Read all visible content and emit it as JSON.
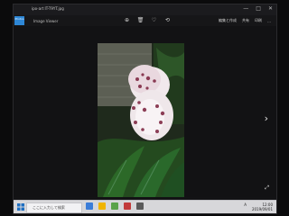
{
  "window": {
    "title": "ipo-art IT-T9YT.jpg",
    "controls": [
      "—",
      "□",
      "✕"
    ]
  },
  "app": {
    "tile_label": "Photos",
    "secondary_label": "Image Viewer"
  },
  "toolbar": {
    "tools": [
      {
        "name": "zoom-icon",
        "glyph": "⊕"
      },
      {
        "name": "delete-icon",
        "glyph": "🗑"
      },
      {
        "name": "favorite-icon",
        "glyph": "♡"
      },
      {
        "name": "rotate-icon",
        "glyph": "⟲"
      }
    ],
    "right": [
      {
        "name": "edit-create-button",
        "label": "編集と作成"
      },
      {
        "name": "share-button",
        "label": "共有"
      },
      {
        "name": "print-button",
        "label": "印刷"
      },
      {
        "name": "more-button",
        "label": "…"
      }
    ]
  },
  "viewer": {
    "next_glyph": "›",
    "expand_glyph": "⤢"
  },
  "taskbar": {
    "search_placeholder": "ここに入力して検索",
    "clock_time": "12:00",
    "clock_date": "2019/09/01",
    "tray_text": "A"
  },
  "colors": {
    "accent": "#2e87d6",
    "taskbar": "#d7d7da"
  }
}
